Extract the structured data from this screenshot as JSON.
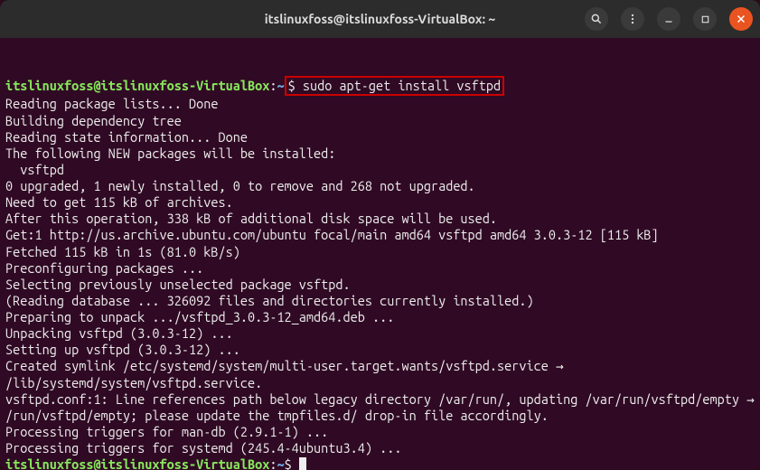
{
  "titlebar": {
    "title": "itslinuxfoss@itslinuxfoss-VirtualBox: ~"
  },
  "prompt": {
    "user_host": "itslinuxfoss@itslinuxfoss-VirtualBox",
    "sep1": ":",
    "path": "~",
    "sep2": "$ "
  },
  "cmd1": "sudo apt-get install vsftpd",
  "output": [
    "Reading package lists... Done",
    "Building dependency tree",
    "Reading state information... Done",
    "The following NEW packages will be installed:",
    "  vsftpd",
    "0 upgraded, 1 newly installed, 0 to remove and 268 not upgraded.",
    "Need to get 115 kB of archives.",
    "After this operation, 338 kB of additional disk space will be used.",
    "Get:1 http://us.archive.ubuntu.com/ubuntu focal/main amd64 vsftpd amd64 3.0.3-12 [115 kB]",
    "Fetched 115 kB in 1s (81.0 kB/s)",
    "Preconfiguring packages ...",
    "Selecting previously unselected package vsftpd.",
    "(Reading database ... 326092 files and directories currently installed.)",
    "Preparing to unpack .../vsftpd_3.0.3-12_amd64.deb ...",
    "Unpacking vsftpd (3.0.3-12) ...",
    "Setting up vsftpd (3.0.3-12) ...",
    "Created symlink /etc/systemd/system/multi-user.target.wants/vsftpd.service → /lib/systemd/system/vsftpd.service.",
    "vsftpd.conf:1: Line references path below legacy directory /var/run/, updating /var/run/vsftpd/empty → /run/vsftpd/empty; please update the tmpfiles.d/ drop-in file accordingly.",
    "Processing triggers for man-db (2.9.1-1) ...",
    "Processing triggers for systemd (245.4-4ubuntu3.4) ..."
  ]
}
